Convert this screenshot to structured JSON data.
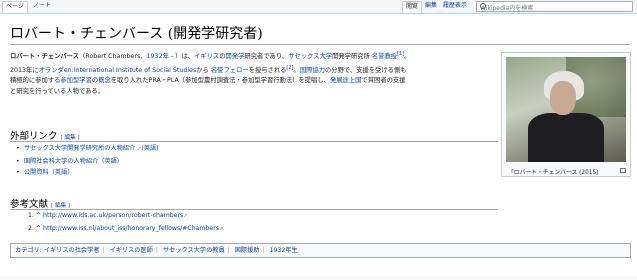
{
  "tabs": {
    "page": "ページ",
    "talk": "ノート",
    "read": "閲覧",
    "edit": "編集",
    "history": "履歴表示"
  },
  "search": {
    "placeholder": "Wikipedia内を検索"
  },
  "title": "ロバート・チェンバース (開発学研究者)",
  "intro": {
    "name_bold": "ロバート・チェンバース",
    "t1": "（Robert Chambers、",
    "year": "1932年",
    "t2": " - ）は、",
    "uk": "イギリス",
    "t3": "の",
    "dev": "開発学",
    "t4": "研究者であり、",
    "sussex": "サセックス大学",
    "t5": "開発学研究所 ",
    "emeritus": "名誉教授",
    "ref1": "[1]",
    "t6": "。",
    "l2a": "2013年に",
    "netherlands": "オランダ",
    "iiss": "en:International Institute of Social Studies",
    "t7": "から ",
    "honorary": "名誉フェロー",
    "t8": "を授与される",
    "ref2": "[2]",
    "t9": "。",
    "coop": "国際協力",
    "t10": "の分野で、支援を受ける側も",
    "l3a": "積極的に参加する",
    "participatory": "参加型学習",
    "t11": "の",
    "concept": "概念",
    "t12": "を取り入れたPRA・PLA（参加型農村調査法・参加型学習行動法）を提唱し、",
    "developing": "発展途上国",
    "t13": "で貧困者の支援",
    "l4": "と研究を行っている人物である。"
  },
  "infobox": {
    "caption": "「ロバート・チェンバース (2015)"
  },
  "external": {
    "heading": "外部リンク",
    "edit_label": "編集",
    "items": [
      {
        "text": "サセックス大学開発学研究所の人物紹介",
        "lang": "(英語)"
      },
      {
        "text": "国際社会科大学の人物紹介（英語）"
      },
      {
        "text": "公開資料（英語）"
      }
    ]
  },
  "references": {
    "heading": "参考文献",
    "edit_label": "編集",
    "items": [
      {
        "num": "1.",
        "caret": "^",
        "url": "http://www.ids.ac.uk/person/robert-chambers"
      },
      {
        "num": "2.",
        "caret": "^",
        "url": "http://www.iss.nl/about_iss/honorary_fellows/#Chambers"
      }
    ]
  },
  "categories": {
    "label": "カテゴリ:",
    "items": [
      "イギリスの社会学者",
      "イギリスの医師",
      "サセックス大学の教員",
      "国際援助",
      "1932年生"
    ]
  }
}
